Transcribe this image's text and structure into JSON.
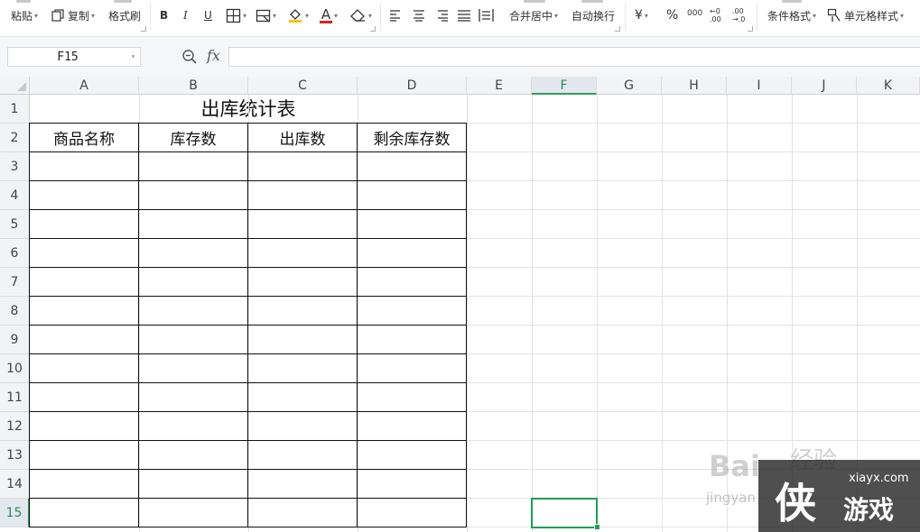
{
  "toolbar": {
    "paste": "粘贴",
    "copy": "复制",
    "format_painter": "格式刷",
    "bold": "B",
    "italic": "I",
    "underline": "U",
    "font_color_glyph": "A",
    "merge_center": "合并居中",
    "wrap_text": "自动换行",
    "currency": "¥",
    "percent": "%",
    "thousands": "000",
    "inc_decimal": "←0\n.00",
    "dec_decimal": ".00\n→.0",
    "conditional_format": "条件格式",
    "cell_style": "单元格样式"
  },
  "formula_bar": {
    "name_box": "F15",
    "fx": "fx",
    "formula_value": ""
  },
  "columns": [
    "A",
    "B",
    "C",
    "D",
    "E",
    "F",
    "G",
    "H",
    "I",
    "J",
    "K"
  ],
  "rows": [
    "1",
    "2",
    "3",
    "4",
    "5",
    "6",
    "7",
    "8",
    "9",
    "10",
    "11",
    "12",
    "13",
    "14",
    "15"
  ],
  "active_cell": {
    "column": "F",
    "row": "15"
  },
  "sheet": {
    "title": "出库统计表",
    "headers": [
      "商品名称",
      "库存数",
      "出库数",
      "剩余库存数"
    ]
  },
  "watermark": {
    "baidu": "Bai",
    "baidu_cn": "经验",
    "jingyan": "jingyan",
    "site": "xiayx.com",
    "brand": "侠",
    "brand_text": "游戏"
  },
  "colors": {
    "accent": "#1f9d55",
    "header_bg": "#f2f3f5",
    "gridline": "#e2e2e2"
  }
}
